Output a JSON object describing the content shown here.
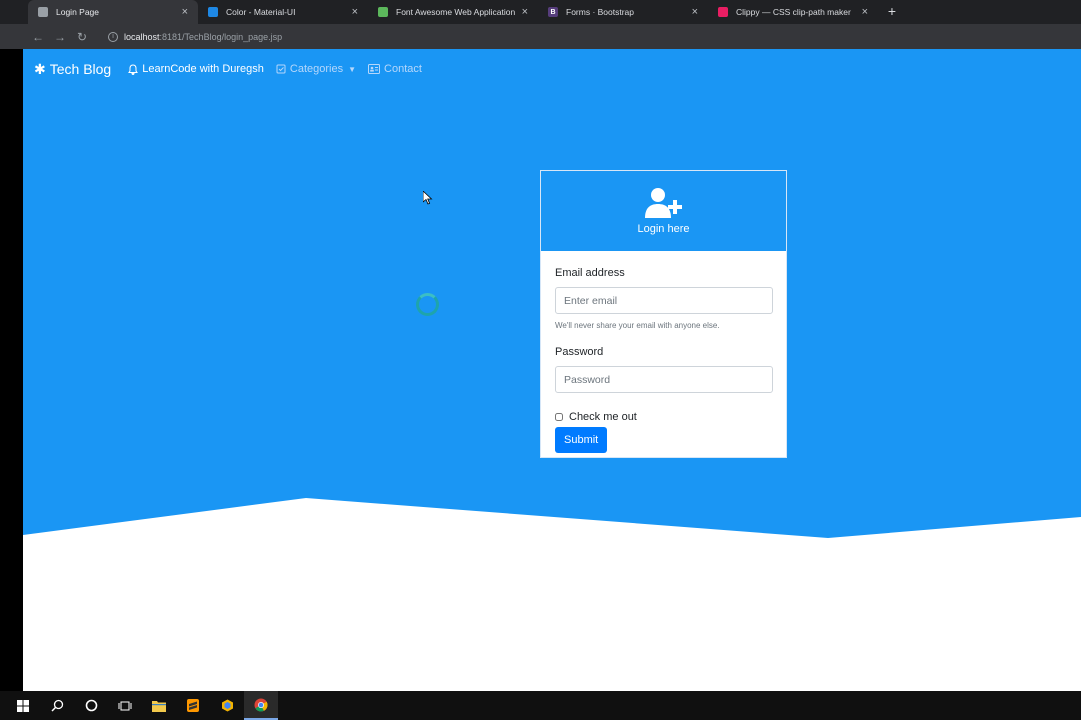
{
  "browser": {
    "tabs": [
      {
        "title": "Login Page",
        "favicon_color": "#9aa0a6",
        "favicon_char": "◉"
      },
      {
        "title": "Color - Material-UI",
        "favicon_color": "#1e88e5",
        "favicon_char": "◆"
      },
      {
        "title": "Font Awesome Web Application",
        "favicon_color": "#5cb85c",
        "favicon_char": "■"
      },
      {
        "title": "Forms · Bootstrap",
        "favicon_color": "#563d7c",
        "favicon_char": "B"
      },
      {
        "title": "Clippy — CSS clip-path maker",
        "favicon_color": "#e91e63",
        "favicon_char": "✂"
      }
    ],
    "new_tab": "+",
    "url_host": "localhost",
    "url_path": ":8181/TechBlog/login_page.jsp"
  },
  "navbar": {
    "brand": "Tech Blog",
    "links": [
      {
        "label": "LearnCode with Duregsh",
        "icon": "bell-icon"
      },
      {
        "label": "Categories",
        "icon": "check-square-icon"
      },
      {
        "label": "Contact",
        "icon": "address-card-icon"
      }
    ]
  },
  "login": {
    "title": "Login here",
    "email_label": "Email address",
    "email_placeholder": "Enter email",
    "email_help": "We'll never share your email with anyone else.",
    "password_label": "Password",
    "password_placeholder": "Password",
    "remember_label": "Check me out",
    "submit_label": "Submit"
  },
  "colors": {
    "primary": "#1a96f4",
    "button": "#007bff"
  }
}
